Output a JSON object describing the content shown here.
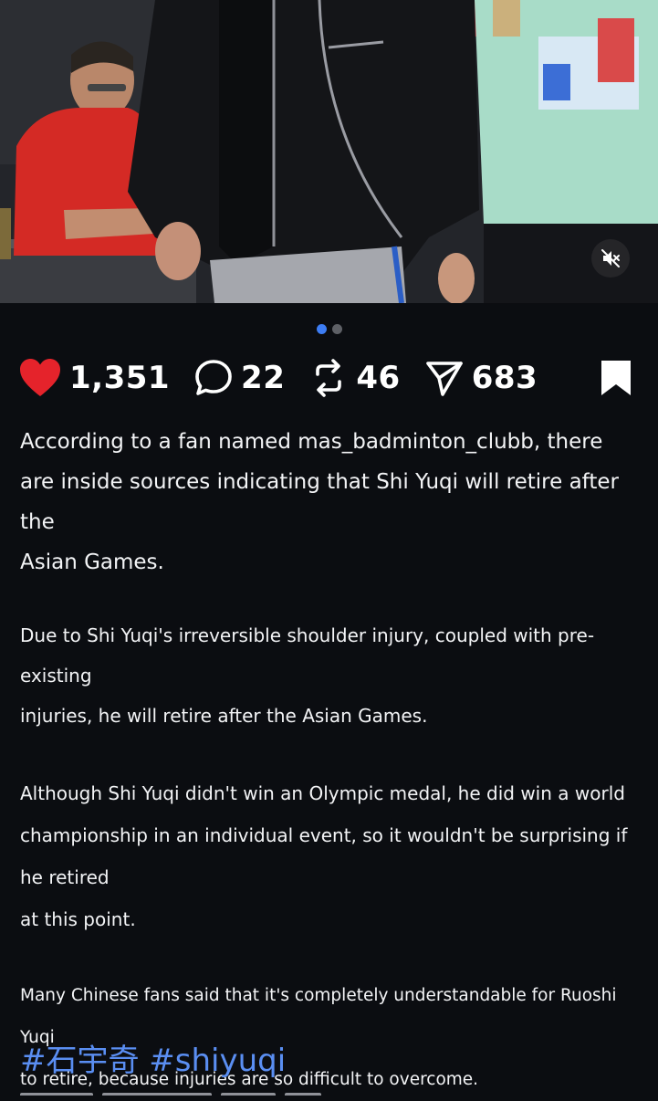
{
  "media": {
    "carousel_total": 2,
    "carousel_active": 1
  },
  "stats": {
    "likes": "1,351",
    "comments": "22",
    "reposts": "46",
    "shares": "683",
    "like_color": "#e5232b"
  },
  "caption": {
    "p1": "According to a fan named mas_badminton_clubb, there\n are inside sources indicating that Shi Yuqi will retire after the\nAsian Games.",
    "p2": " Due to Shi Yuqi's irreversible shoulder injury, coupled with pre-existing\ninjuries, he will retire after the Asian Games.",
    "p3": "Although Shi Yuqi didn't win an Olympic medal, he did win a world\nchampionship in an individual event, so it wouldn't be surprising if he retired\nat this point.",
    "p4": "Many Chinese fans said that it's completely understandable for Ruoshi Yuqi\nto retire, because injuries are so difficult to overcome."
  },
  "hashtags": "#石宇奇 #shiyuqi",
  "colors": {
    "background": "#0b0d11",
    "accent": "#3d7df4",
    "hashtag": "#5a8ef2"
  },
  "icons": [
    "heart-icon",
    "comment-icon",
    "repost-icon",
    "share-icon",
    "bookmark-icon",
    "mute-icon"
  ]
}
